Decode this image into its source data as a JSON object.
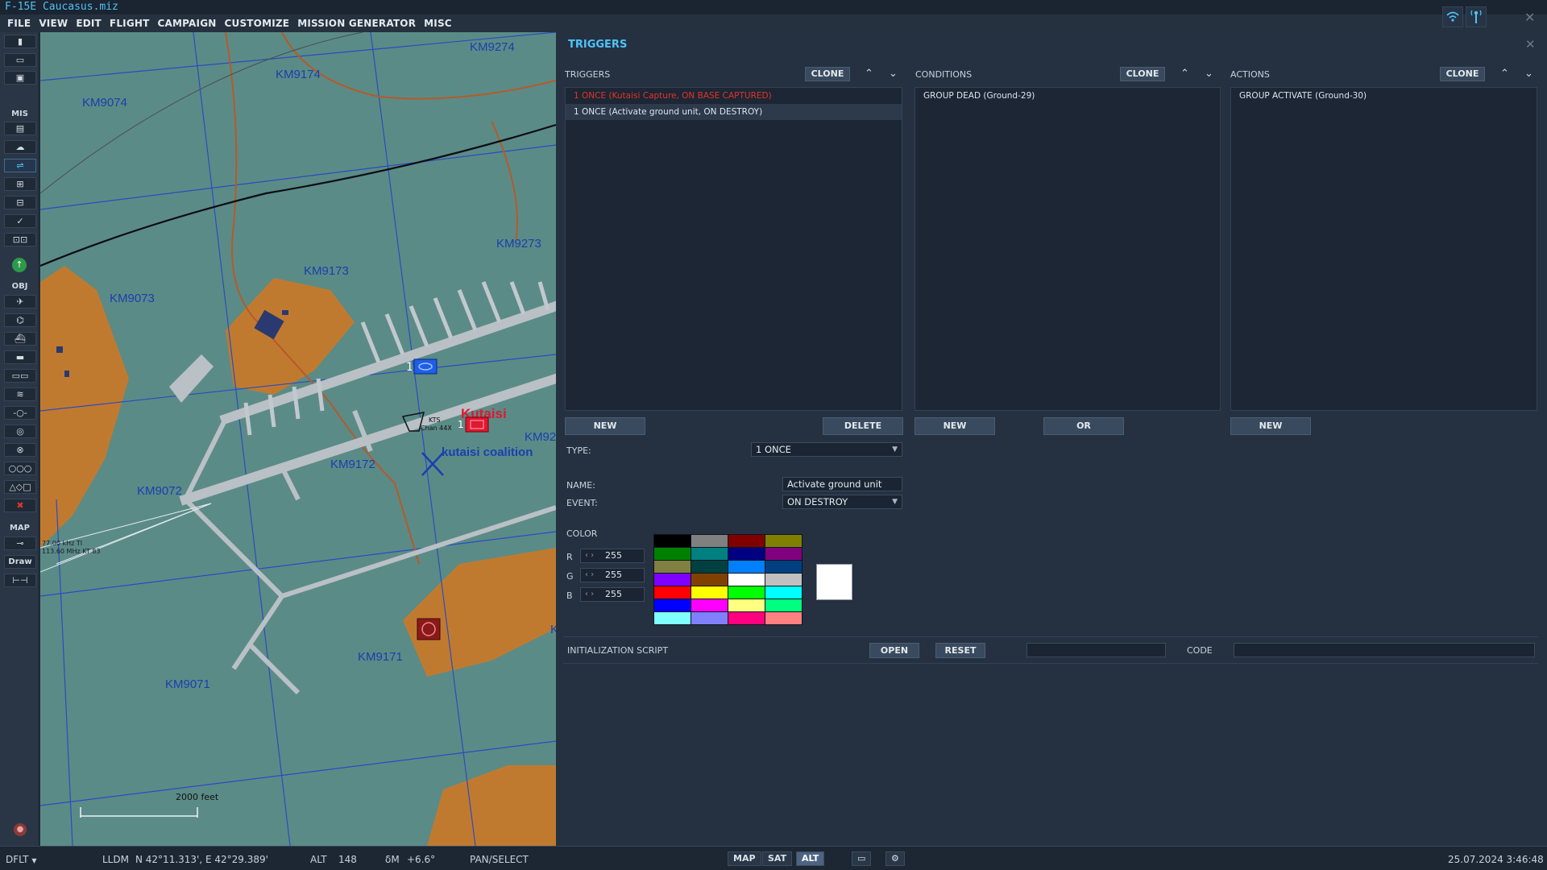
{
  "app": {
    "title": "F-15E Caucasus.miz"
  },
  "menu": [
    "FILE",
    "VIEW",
    "EDIT",
    "FLIGHT",
    "CAMPAIGN",
    "CUSTOMIZE",
    "MISSION GENERATOR",
    "MISC"
  ],
  "toolbar": {
    "sections": [
      "MIS",
      "OBJ",
      "MAP"
    ],
    "draw_label": "Draw"
  },
  "map": {
    "grid_labels": [
      "KM9274",
      "KM9174",
      "KM9074",
      "KM9273",
      "KM9173",
      "KM9073",
      "KM9172",
      "KM9072",
      "KM9171",
      "KM9071",
      "KM92",
      "K"
    ],
    "airbase_name": "Kutaisi",
    "coalition_label": "kutaisi coalition",
    "tacan_text": [
      "KTS",
      "Chan 44X"
    ],
    "ils_text": [
      "77.00 kHz TI",
      "113.60 MHz KT 83"
    ],
    "unit_counts": [
      "1",
      "1"
    ],
    "scale_label": "2000 feet"
  },
  "triggers_panel": {
    "title": "TRIGGERS",
    "triggers": {
      "header": "TRIGGERS",
      "clone_label": "CLONE",
      "items": [
        {
          "text": "1 ONCE (Kutaisi Capture, ON BASE CAPTURED)",
          "color": "#e0342b"
        },
        {
          "text": "1 ONCE (Activate ground unit, ON DESTROY)",
          "selected": true
        }
      ],
      "new_label": "NEW",
      "delete_label": "DELETE"
    },
    "conditions": {
      "header": "CONDITIONS",
      "clone_label": "CLONE",
      "items": [
        "GROUP DEAD (Ground-29)"
      ],
      "new_label": "NEW",
      "or_label": "OR"
    },
    "actions": {
      "header": "ACTIONS",
      "clone_label": "CLONE",
      "items": [
        "GROUP ACTIVATE (Ground-30)"
      ],
      "new_label": "NEW"
    },
    "type": {
      "label": "TYPE:",
      "value": "1 ONCE"
    },
    "name": {
      "label": "NAME:",
      "value": "Activate ground unit"
    },
    "event": {
      "label": "EVENT:",
      "value": "ON DESTROY"
    },
    "color": {
      "label": "COLOR",
      "r": {
        "label": "R",
        "value": "255"
      },
      "g": {
        "label": "G",
        "value": "255"
      },
      "b": {
        "label": "B",
        "value": "255"
      },
      "palette": [
        "#000000",
        "#808080",
        "#800000",
        "#808000",
        "#008000",
        "#008080",
        "#000080",
        "#800080",
        "#808040",
        "#004040",
        "#0080ff",
        "#004080",
        "#8000ff",
        "#804000",
        "#ffffff",
        "#c0c0c0",
        "#ff0000",
        "#ffff00",
        "#00ff00",
        "#00ffff",
        "#0000ff",
        "#ff00ff",
        "#ffff80",
        "#00ff80",
        "#80ffff",
        "#8080ff",
        "#ff0080",
        "#ff8080"
      ],
      "preview": "#ffffff"
    },
    "init_script": {
      "label": "INITIALIZATION SCRIPT",
      "open_label": "OPEN",
      "reset_label": "RESET",
      "file_value": "",
      "code_label": "CODE",
      "code_value": ""
    }
  },
  "statusbar": {
    "profile": "DFLT",
    "coord_mode": "LLDM",
    "coords": "N 42°11.313', E 42°29.389'",
    "alt_label": "ALT",
    "alt_value": "148",
    "mag_label": "δM",
    "mag_value": "+6.6°",
    "mode": "PAN/SELECT",
    "map_buttons": [
      "MAP",
      "SAT",
      "ALT"
    ],
    "active_map_button": "ALT",
    "datetime": "25.07.2024 3:46:48"
  }
}
